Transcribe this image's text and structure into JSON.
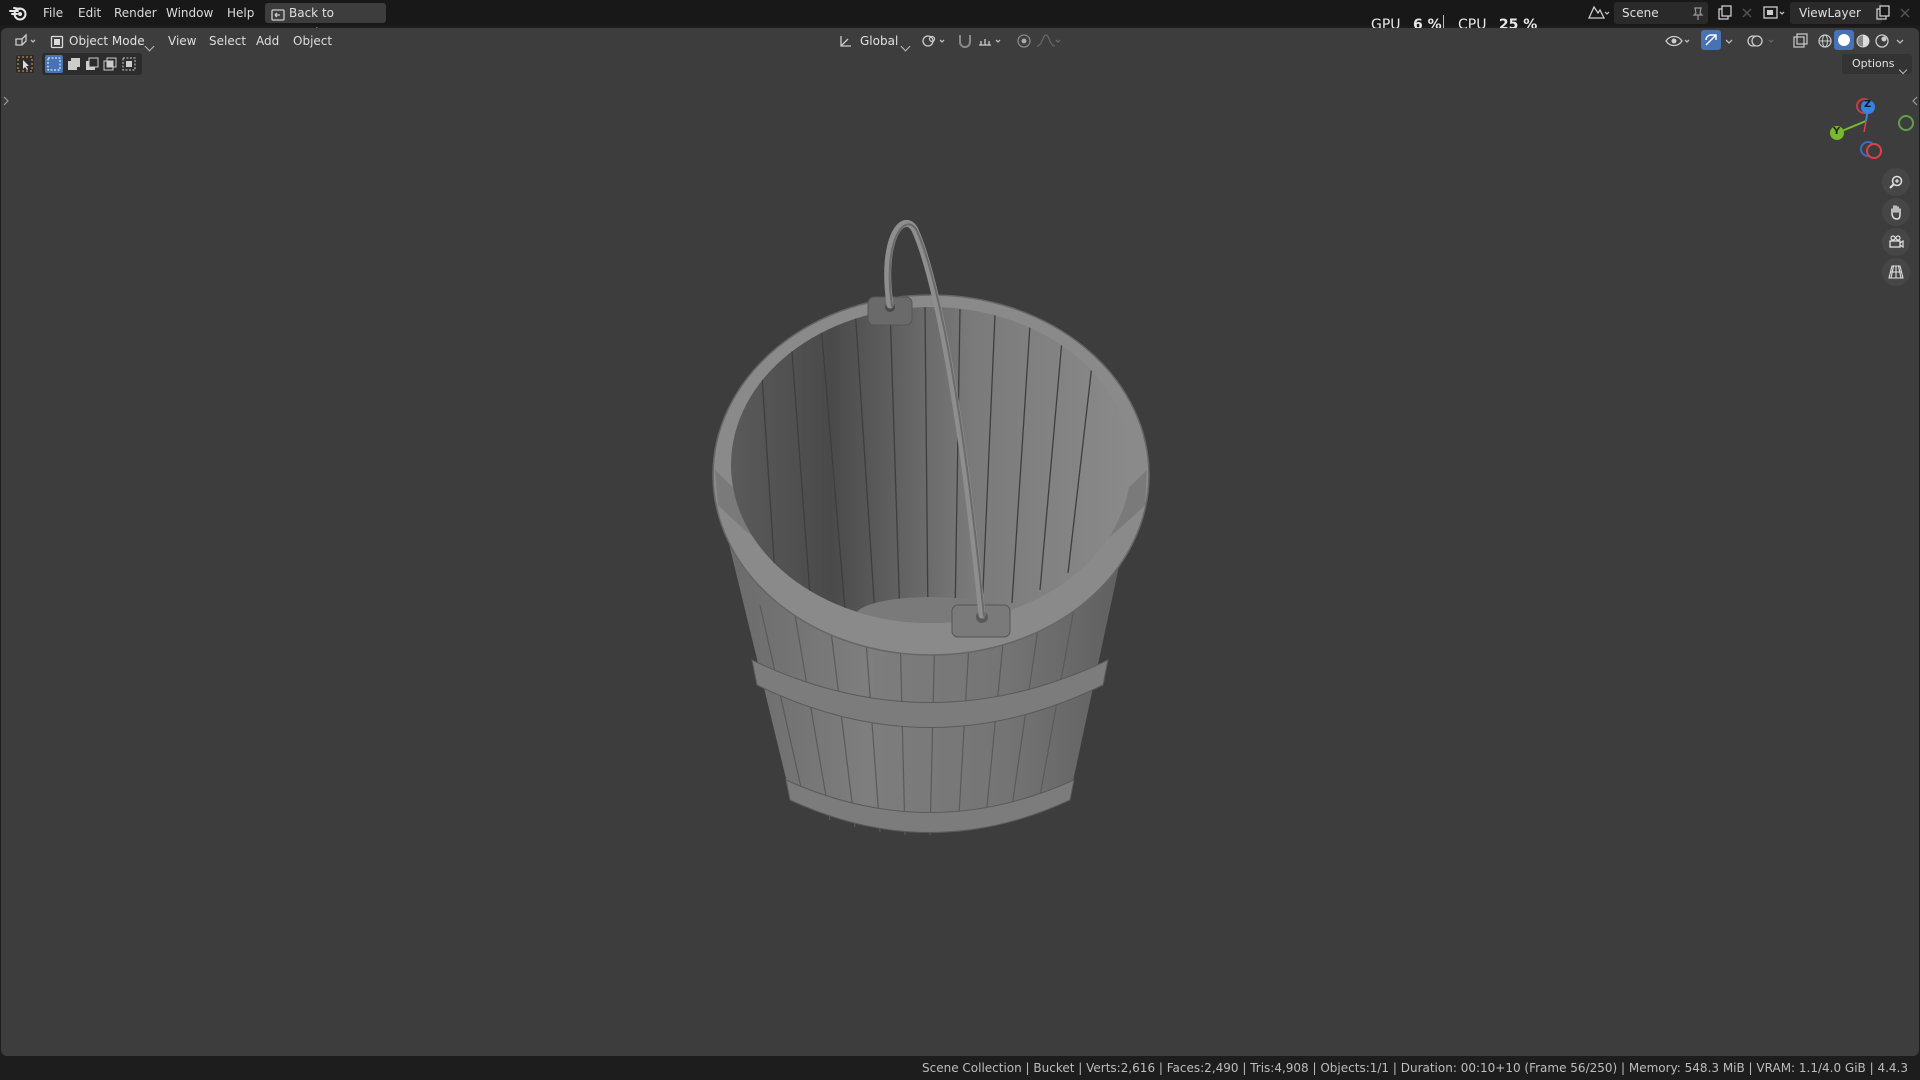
{
  "menu": {
    "items": [
      "File",
      "Edit",
      "Render",
      "Window",
      "Help"
    ],
    "back_button": "Back to Previous"
  },
  "stats": {
    "gpu_label": "GPU",
    "gpu_value": "6 %",
    "cpu_label": "CPU",
    "cpu_value": "25 %"
  },
  "scene": {
    "name": "Scene"
  },
  "view_layer": {
    "name": "ViewLayer"
  },
  "viewport_header": {
    "mode": "Object Mode",
    "menus": [
      "View",
      "Select",
      "Add",
      "Object"
    ],
    "transform_orientation": "Global",
    "options_label": "Options"
  },
  "gizmo": {
    "x_label": "X",
    "y_label": "Y",
    "z_label": "Z"
  },
  "status_bar": {
    "text": "Scene Collection | Bucket | Verts:2,616 | Faces:2,490 | Tris:4,908 | Objects:1/1 | Duration: 00:10+10 (Frame 56/250) | Memory: 548.3 MiB | VRAM: 1.1/4.0 GiB | 4.4.3"
  },
  "colors": {
    "viewport_bg": "#3d3d3d",
    "topbar_bg": "#181818",
    "accent_blue": "#4772b3",
    "axis_x": "#e0404a",
    "axis_y": "#7ab82f",
    "axis_z": "#3b82e0"
  }
}
